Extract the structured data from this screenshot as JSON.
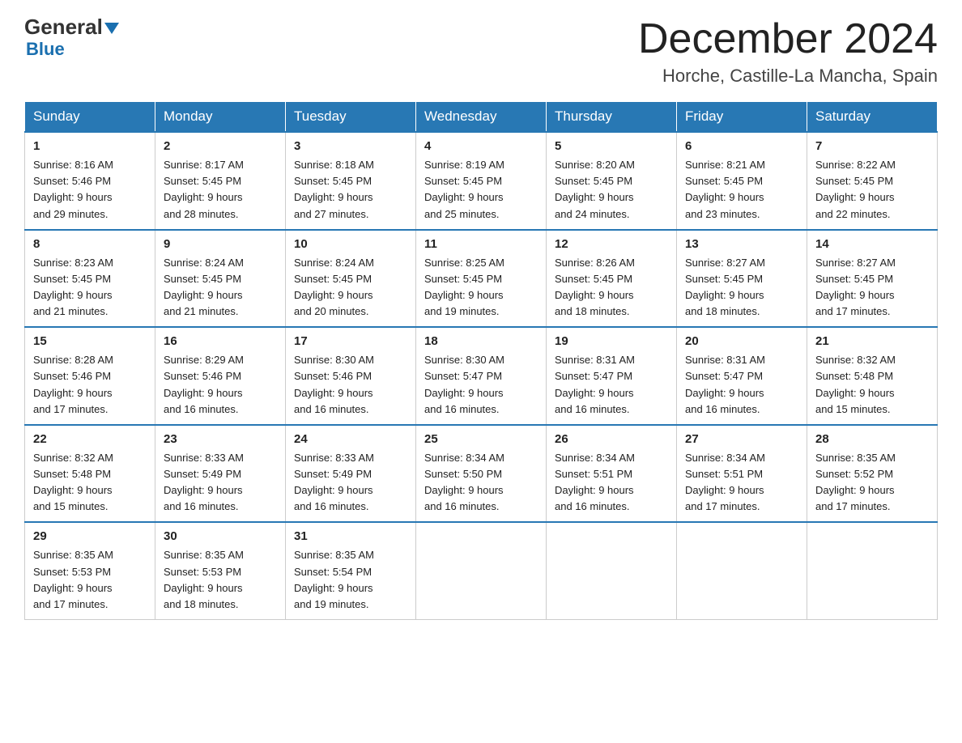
{
  "logo": {
    "text1": "General",
    "text2": "Blue"
  },
  "header": {
    "month_title": "December 2024",
    "location": "Horche, Castille-La Mancha, Spain"
  },
  "days_of_week": [
    "Sunday",
    "Monday",
    "Tuesday",
    "Wednesday",
    "Thursday",
    "Friday",
    "Saturday"
  ],
  "weeks": [
    [
      {
        "day": "1",
        "sunrise": "8:16 AM",
        "sunset": "5:46 PM",
        "daylight": "9 hours and 29 minutes."
      },
      {
        "day": "2",
        "sunrise": "8:17 AM",
        "sunset": "5:45 PM",
        "daylight": "9 hours and 28 minutes."
      },
      {
        "day": "3",
        "sunrise": "8:18 AM",
        "sunset": "5:45 PM",
        "daylight": "9 hours and 27 minutes."
      },
      {
        "day": "4",
        "sunrise": "8:19 AM",
        "sunset": "5:45 PM",
        "daylight": "9 hours and 25 minutes."
      },
      {
        "day": "5",
        "sunrise": "8:20 AM",
        "sunset": "5:45 PM",
        "daylight": "9 hours and 24 minutes."
      },
      {
        "day": "6",
        "sunrise": "8:21 AM",
        "sunset": "5:45 PM",
        "daylight": "9 hours and 23 minutes."
      },
      {
        "day": "7",
        "sunrise": "8:22 AM",
        "sunset": "5:45 PM",
        "daylight": "9 hours and 22 minutes."
      }
    ],
    [
      {
        "day": "8",
        "sunrise": "8:23 AM",
        "sunset": "5:45 PM",
        "daylight": "9 hours and 21 minutes."
      },
      {
        "day": "9",
        "sunrise": "8:24 AM",
        "sunset": "5:45 PM",
        "daylight": "9 hours and 21 minutes."
      },
      {
        "day": "10",
        "sunrise": "8:24 AM",
        "sunset": "5:45 PM",
        "daylight": "9 hours and 20 minutes."
      },
      {
        "day": "11",
        "sunrise": "8:25 AM",
        "sunset": "5:45 PM",
        "daylight": "9 hours and 19 minutes."
      },
      {
        "day": "12",
        "sunrise": "8:26 AM",
        "sunset": "5:45 PM",
        "daylight": "9 hours and 18 minutes."
      },
      {
        "day": "13",
        "sunrise": "8:27 AM",
        "sunset": "5:45 PM",
        "daylight": "9 hours and 18 minutes."
      },
      {
        "day": "14",
        "sunrise": "8:27 AM",
        "sunset": "5:45 PM",
        "daylight": "9 hours and 17 minutes."
      }
    ],
    [
      {
        "day": "15",
        "sunrise": "8:28 AM",
        "sunset": "5:46 PM",
        "daylight": "9 hours and 17 minutes."
      },
      {
        "day": "16",
        "sunrise": "8:29 AM",
        "sunset": "5:46 PM",
        "daylight": "9 hours and 16 minutes."
      },
      {
        "day": "17",
        "sunrise": "8:30 AM",
        "sunset": "5:46 PM",
        "daylight": "9 hours and 16 minutes."
      },
      {
        "day": "18",
        "sunrise": "8:30 AM",
        "sunset": "5:47 PM",
        "daylight": "9 hours and 16 minutes."
      },
      {
        "day": "19",
        "sunrise": "8:31 AM",
        "sunset": "5:47 PM",
        "daylight": "9 hours and 16 minutes."
      },
      {
        "day": "20",
        "sunrise": "8:31 AM",
        "sunset": "5:47 PM",
        "daylight": "9 hours and 16 minutes."
      },
      {
        "day": "21",
        "sunrise": "8:32 AM",
        "sunset": "5:48 PM",
        "daylight": "9 hours and 15 minutes."
      }
    ],
    [
      {
        "day": "22",
        "sunrise": "8:32 AM",
        "sunset": "5:48 PM",
        "daylight": "9 hours and 15 minutes."
      },
      {
        "day": "23",
        "sunrise": "8:33 AM",
        "sunset": "5:49 PM",
        "daylight": "9 hours and 16 minutes."
      },
      {
        "day": "24",
        "sunrise": "8:33 AM",
        "sunset": "5:49 PM",
        "daylight": "9 hours and 16 minutes."
      },
      {
        "day": "25",
        "sunrise": "8:34 AM",
        "sunset": "5:50 PM",
        "daylight": "9 hours and 16 minutes."
      },
      {
        "day": "26",
        "sunrise": "8:34 AM",
        "sunset": "5:51 PM",
        "daylight": "9 hours and 16 minutes."
      },
      {
        "day": "27",
        "sunrise": "8:34 AM",
        "sunset": "5:51 PM",
        "daylight": "9 hours and 17 minutes."
      },
      {
        "day": "28",
        "sunrise": "8:35 AM",
        "sunset": "5:52 PM",
        "daylight": "9 hours and 17 minutes."
      }
    ],
    [
      {
        "day": "29",
        "sunrise": "8:35 AM",
        "sunset": "5:53 PM",
        "daylight": "9 hours and 17 minutes."
      },
      {
        "day": "30",
        "sunrise": "8:35 AM",
        "sunset": "5:53 PM",
        "daylight": "9 hours and 18 minutes."
      },
      {
        "day": "31",
        "sunrise": "8:35 AM",
        "sunset": "5:54 PM",
        "daylight": "9 hours and 19 minutes."
      },
      null,
      null,
      null,
      null
    ]
  ],
  "labels": {
    "sunrise": "Sunrise:",
    "sunset": "Sunset:",
    "daylight": "Daylight:"
  }
}
